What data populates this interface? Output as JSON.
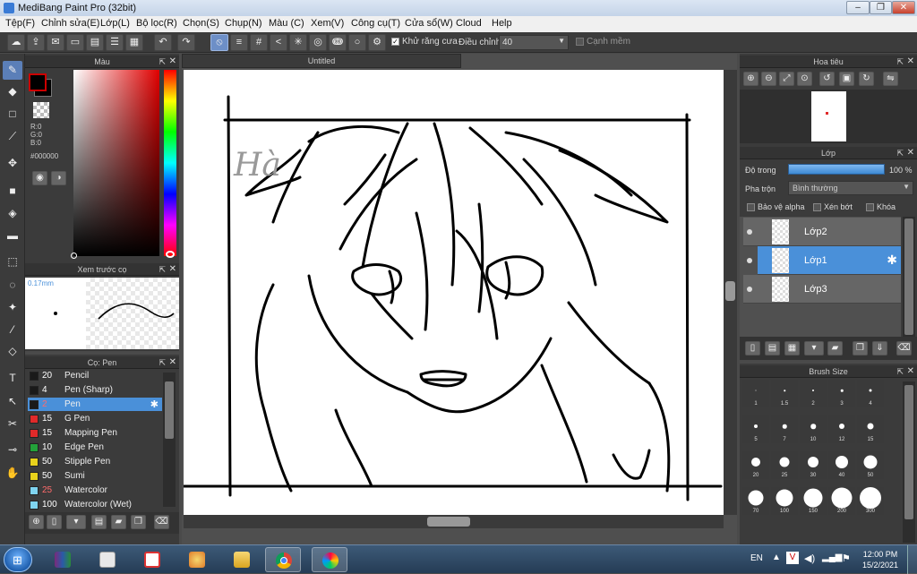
{
  "window": {
    "title": "MediBang Paint Pro (32bit)",
    "controls": [
      "–",
      "❐",
      "✕"
    ]
  },
  "menu": [
    "Tệp(F)",
    "Chỉnh sửa(E)",
    "Lớp(L)",
    "Bộ lọc(R)",
    "Chọn(S)",
    "Chụp(N)",
    "Màu (C)",
    "Xem(V)",
    "Công cụ(T)",
    "Cửa sổ(W)",
    "Cloud",
    "Help"
  ],
  "toolbar": {
    "antialias_label": "Khử răng cưa",
    "correction_label": "Điều chỉnh",
    "correction_value": "40",
    "soft_edge_label": "Cạnh mềm"
  },
  "color_panel": {
    "title": "Màu",
    "r": "R:0",
    "g": "G:0",
    "b": "B:0",
    "hex": "#000000",
    "foreground": "#000000",
    "background": "#000000"
  },
  "brush_preview": {
    "title": "Xem trước cọ",
    "size": "0.17mm"
  },
  "brush_panel": {
    "title": "Cọ: Pen",
    "items": [
      {
        "size": "20",
        "name": "Pencil",
        "color": "#1a1a1a",
        "size_color": "#ffffff"
      },
      {
        "size": "4",
        "name": "Pen (Sharp)",
        "color": "#1a1a1a",
        "size_color": "#ffffff"
      },
      {
        "size": "2",
        "name": "Pen",
        "color": "#1a1a1a",
        "size_color": "#ff6b6b"
      },
      {
        "size": "15",
        "name": "G Pen",
        "color": "#e02a2a",
        "size_color": "#ffffff"
      },
      {
        "size": "15",
        "name": "Mapping Pen",
        "color": "#e02a2a",
        "size_color": "#ffffff"
      },
      {
        "size": "10",
        "name": "Edge Pen",
        "color": "#23a23a",
        "size_color": "#ffffff"
      },
      {
        "size": "50",
        "name": "Stipple Pen",
        "color": "#e8d21c",
        "size_color": "#ffffff"
      },
      {
        "size": "50",
        "name": "Sumi",
        "color": "#e8d21c",
        "size_color": "#ffffff"
      },
      {
        "size": "25",
        "name": "Watercolor",
        "color": "#7fd4f0",
        "size_color": "#ff6b6b"
      },
      {
        "size": "100",
        "name": "Watercolor (Wet)",
        "color": "#7fd4f0",
        "size_color": "#ffffff"
      }
    ]
  },
  "canvas": {
    "tab_title": "Untitled",
    "signature": "Hà"
  },
  "navigator": {
    "title": "Hoa tiêu"
  },
  "layer_panel": {
    "title": "Lớp",
    "opacity_label": "Độ trong",
    "opacity_value": "100 %",
    "blend_label": "Pha trộn",
    "blend_value": "Bình thường",
    "protect_alpha": "Bảo vệ alpha",
    "clipping": "Xén bớt",
    "lock": "Khóa",
    "layers": [
      "Lớp2",
      "Lớp1",
      "Lớp3"
    ]
  },
  "brush_size_panel": {
    "title": "Brush Size",
    "sizes": [
      "1",
      "1.5",
      "2",
      "3",
      "4",
      "5",
      "7",
      "10",
      "12",
      "15",
      "20",
      "25",
      "30",
      "40",
      "50",
      "70",
      "100",
      "150",
      "200",
      "300"
    ]
  },
  "taskbar": {
    "lang": "EN",
    "time": "12:00 PM",
    "date": "15/2/2021"
  }
}
